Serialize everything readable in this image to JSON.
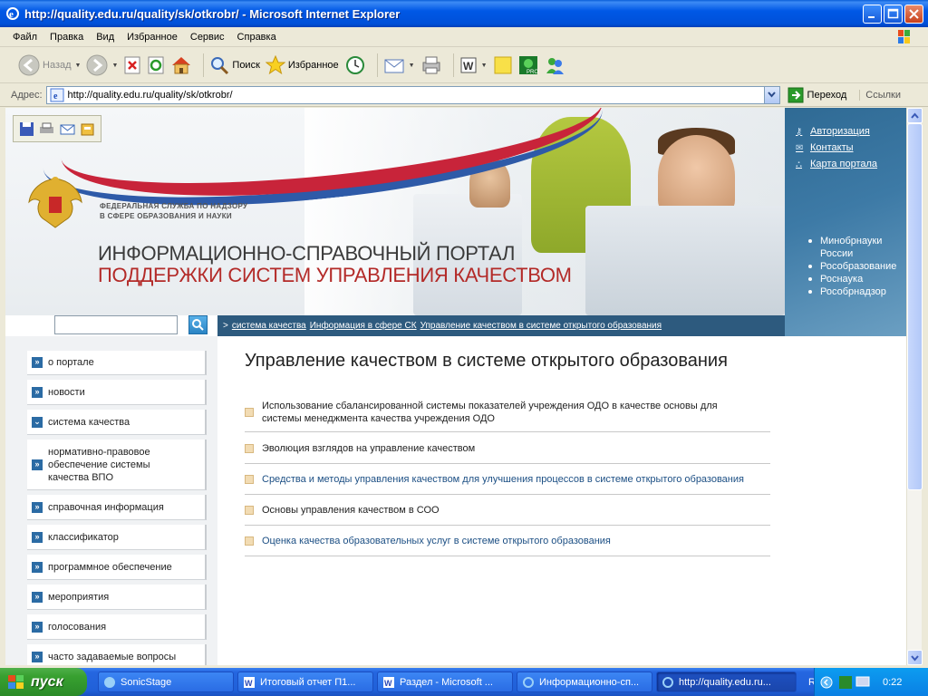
{
  "window": {
    "title": "http://quality.edu.ru/quality/sk/otkrobr/ - Microsoft Internet Explorer"
  },
  "menu": [
    "Файл",
    "Правка",
    "Вид",
    "Избранное",
    "Сервис",
    "Справка"
  ],
  "toolbar": {
    "back": "Назад",
    "search": "Поиск",
    "favorites": "Избранное"
  },
  "address": {
    "label": "Адрес:",
    "url": "http://quality.edu.ru/quality/sk/otkrobr/",
    "go": "Переход",
    "links": "Ссылки"
  },
  "header": {
    "agency_line1": "ФЕДЕРАЛЬНАЯ СЛУЖБА ПО НАДЗОРУ",
    "agency_line2": "В СФЕРЕ ОБРАЗОВАНИЯ И НАУКИ",
    "portal_line1": "ИНФОРМАЦИОННО-СПРАВОЧНЫЙ ПОРТАЛ",
    "portal_line2": "ПОДДЕРЖКИ СИСТЕМ УПРАВЛЕНИЯ КАЧЕСТВОМ"
  },
  "toplinks": [
    "Авторизация",
    "Контакты",
    "Карта портала"
  ],
  "sites": [
    "Минобрнауки России",
    "Рособразование",
    "Роснаука",
    "Рособрнадзор"
  ],
  "breadcrumb": {
    "sep": ">",
    "items": [
      "система качества",
      "Информация в сфере СК",
      "Управление качеством в системе открытого образования"
    ]
  },
  "nav": [
    "о портале",
    "новости",
    "система качества",
    "нормативно-правовое обеспечение системы качества ВПО",
    "справочная информация",
    "классификатор",
    "программное обеспечение",
    "мероприятия",
    "голосования",
    "часто задаваемые вопросы"
  ],
  "main": {
    "title": "Управление качеством в системе открытого образования",
    "articles": [
      "Использование сбалансированной системы показателей учреждения ОДО в качестве основы для системы менеджмента качества учреждения ОДО",
      "Эволюция взглядов на управление качеством",
      "Средства и методы управления качеством для улучшения процессов в системе открытого образования",
      "Основы управления качеством в СОО",
      "Оценка качества образовательных услуг в системе открытого образования"
    ]
  },
  "taskbar": {
    "start": "пуск",
    "tasks": [
      "SonicStage",
      "Итоговый отчет П1...",
      "Раздел - Microsoft ...",
      "Информационно-сп...",
      "http://quality.edu.ru..."
    ],
    "lang": "RU",
    "clock": "0:22"
  }
}
